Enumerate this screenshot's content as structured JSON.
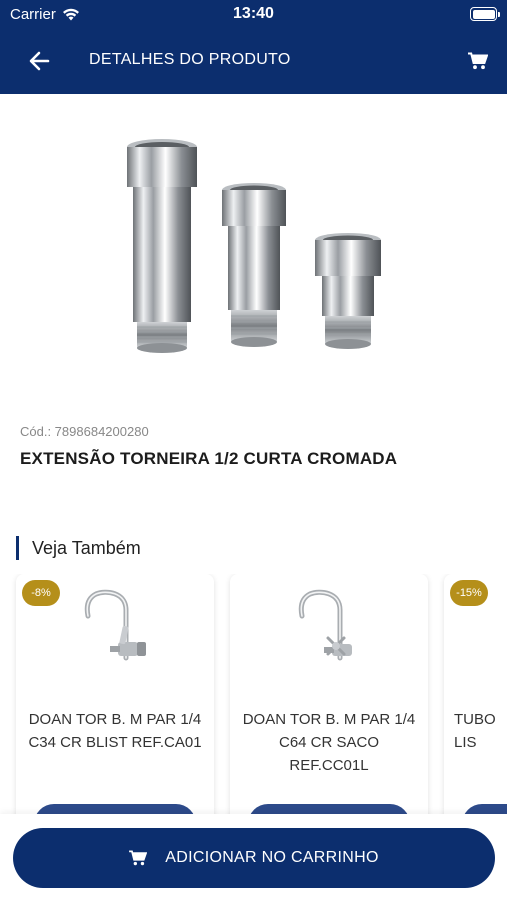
{
  "status_bar": {
    "carrier": "Carrier",
    "time": "13:40"
  },
  "nav": {
    "title": "DETALHES DO PRODUTO",
    "back_icon": "arrow-left-icon",
    "cart_icon": "cart-icon"
  },
  "product": {
    "code_label": "Cód.: 7898684200280",
    "name": "EXTENSÃO TORNEIRA 1/2 CURTA CROMADA"
  },
  "related": {
    "title": "Veja Também",
    "items": [
      {
        "discount": "-8%",
        "name": "DOAN TOR B. M PAR 1/4 C34 CR BLIST REF.CA01"
      },
      {
        "discount": "",
        "name": "DOAN TOR B. M PAR 1/4 C64 CR SACO REF.CC01L"
      },
      {
        "discount": "-15%",
        "name": "TUBO LIS"
      }
    ]
  },
  "cta": {
    "label": "ADICIONAR NO CARRINHO"
  },
  "colors": {
    "primary": "#0c2e6e",
    "badge": "#b58f1a",
    "card_button": "#2d4a8a"
  }
}
